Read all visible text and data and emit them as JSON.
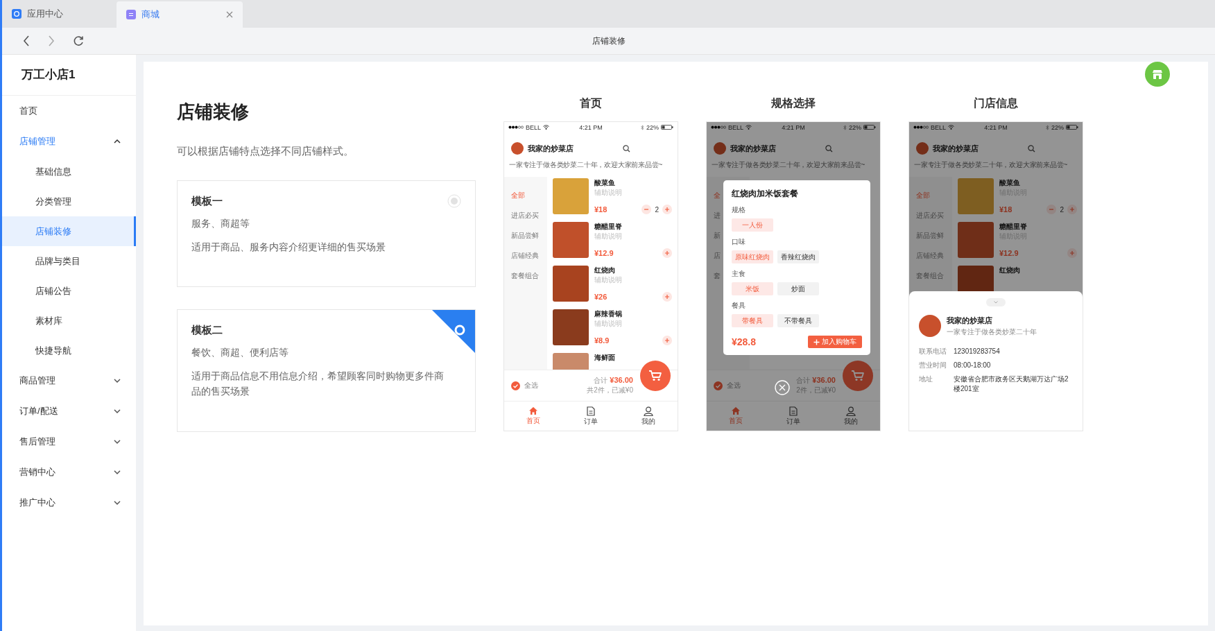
{
  "browser_tabs": [
    {
      "label": "应用中心",
      "selected": false,
      "closable": false
    },
    {
      "label": "商城",
      "selected": true,
      "closable": true
    }
  ],
  "page_title": "店铺装修",
  "sidebar": {
    "store_name": "万工小店1",
    "items": [
      {
        "kind": "link",
        "label": "首页"
      },
      {
        "kind": "group",
        "label": "店铺管理",
        "expanded": true,
        "children": [
          {
            "label": "基础信息",
            "selected": false
          },
          {
            "label": "分类管理",
            "selected": false
          },
          {
            "label": "店铺装修",
            "selected": true
          },
          {
            "label": "品牌与类目",
            "selected": false
          },
          {
            "label": "店铺公告",
            "selected": false
          },
          {
            "label": "素材库",
            "selected": false
          },
          {
            "label": "快捷导航",
            "selected": false
          }
        ]
      },
      {
        "kind": "group",
        "label": "商品管理",
        "expanded": false
      },
      {
        "kind": "group",
        "label": "订单/配送",
        "expanded": false
      },
      {
        "kind": "group",
        "label": "售后管理",
        "expanded": false
      },
      {
        "kind": "group",
        "label": "营销中心",
        "expanded": false
      },
      {
        "kind": "group",
        "label": "推广中心",
        "expanded": false
      }
    ]
  },
  "main": {
    "heading": "店铺装修",
    "description": "可以根据店铺特点选择不同店铺样式。",
    "templates": [
      {
        "title": "模板一",
        "tags": "服务、商超等",
        "description": "适用于商品、服务内容介绍更详细的售买场景",
        "selected": false
      },
      {
        "title": "模板二",
        "tags": "餐饮、商超、便利店等",
        "description": "适用于商品信息不用信息介绍，希望顾客同时购物更多件商品的售买场景",
        "selected": true
      }
    ]
  },
  "previews": [
    {
      "kind": "menu",
      "title": "首页",
      "status": {
        "carrier": "BELL",
        "time": "4:21 PM",
        "battery": "22%"
      },
      "shop": {
        "name": "我家的炒菜店",
        "desc": "一家专注于做各类炒菜二十年，欢迎大家前来品尝~"
      },
      "categories": [
        {
          "label": "全部",
          "selected": true
        },
        {
          "label": "进店必买",
          "selected": false
        },
        {
          "label": "新品尝鲜",
          "selected": false
        },
        {
          "label": "店铺经典",
          "selected": false
        },
        {
          "label": "套餐组合",
          "selected": false
        }
      ],
      "dishes": [
        {
          "name": "酸菜鱼",
          "note": "辅助说明",
          "price": "¥18",
          "qty": "2"
        },
        {
          "name": "糖醋里脊",
          "note": "辅助说明",
          "price": "¥12.9"
        },
        {
          "name": "红烧肉",
          "note": "辅助说明",
          "price": "¥26"
        },
        {
          "name": "麻辣香锅",
          "note": "辅助说明",
          "price": "¥8.9"
        },
        {
          "name": "海鲜面"
        }
      ],
      "cart": {
        "select_all": "全选",
        "checked": true,
        "total_label": "合计",
        "total": "¥36.00",
        "summary": "共2件，已减¥0"
      },
      "tabs": [
        {
          "label": "首页",
          "selected": true
        },
        {
          "label": "订单",
          "selected": false
        },
        {
          "label": "我的",
          "selected": false
        }
      ]
    },
    {
      "kind": "spec",
      "title": "规格选择",
      "status": {
        "carrier": "BELL",
        "time": "4:21 PM",
        "battery": "22%"
      },
      "shop": {
        "name": "我家的炒菜店",
        "desc": "一家专注于做各类炒菜二十年，欢迎大家前来品尝~"
      },
      "categories": [
        {
          "label": "全",
          "selected": true
        },
        {
          "label": "进",
          "selected": false
        },
        {
          "label": "新",
          "selected": false
        },
        {
          "label": "店",
          "selected": false
        },
        {
          "label": "套",
          "selected": false
        }
      ],
      "cart": {
        "select_all": "全选",
        "checked": true,
        "total_label": "合计",
        "total": "¥36.00",
        "summary": "2件，已减¥0"
      },
      "tabs": [
        {
          "label": "首页",
          "selected": true
        },
        {
          "label": "订单",
          "selected": false
        },
        {
          "label": "我的",
          "selected": false
        }
      ],
      "spec": {
        "title": "红烧肉加米饭套餐",
        "groups": [
          {
            "label": "规格",
            "options": [
              {
                "label": "一人份",
                "selected": true
              }
            ]
          },
          {
            "label": "口味",
            "options": [
              {
                "label": "原味红烧肉",
                "selected": true
              },
              {
                "label": "香辣红烧肉",
                "selected": false
              }
            ]
          },
          {
            "label": "主食",
            "options": [
              {
                "label": "米饭",
                "selected": true
              },
              {
                "label": "炒面",
                "selected": false
              }
            ]
          },
          {
            "label": "餐具",
            "options": [
              {
                "label": "带餐具",
                "selected": true
              },
              {
                "label": "不带餐具",
                "selected": false
              }
            ]
          }
        ],
        "price": "¥28.8",
        "add_button": "加入购物车"
      }
    },
    {
      "kind": "info",
      "title": "门店信息",
      "status": {
        "carrier": "BELL",
        "time": "4:21 PM",
        "battery": "22%"
      },
      "shop": {
        "name": "我家的炒菜店",
        "desc": "一家专注于做各类炒菜二十年，欢迎大家前来品尝~"
      },
      "categories": [
        {
          "label": "全部",
          "selected": true
        },
        {
          "label": "进店必买",
          "selected": false
        },
        {
          "label": "新品尝鲜",
          "selected": false
        },
        {
          "label": "店铺经典",
          "selected": false
        },
        {
          "label": "套餐组合",
          "selected": false
        }
      ],
      "dishes": [
        {
          "name": "酸菜鱼",
          "note": "辅助说明",
          "price": "¥18",
          "qty": "2"
        },
        {
          "name": "糖醋里脊",
          "note": "辅助说明",
          "price": "¥12.9"
        },
        {
          "name": "红烧肉"
        }
      ],
      "info": {
        "name": "我家的炒菜店",
        "desc": "一家专注于做各类炒菜二十年",
        "rows": [
          {
            "label": "联系电话",
            "value": "123019283754"
          },
          {
            "label": "营业时间",
            "value": "08:00-18:00"
          },
          {
            "label": "地址",
            "value": "安徽省合肥市政务区天鹅湖万达广场2楼201室"
          }
        ]
      }
    }
  ]
}
